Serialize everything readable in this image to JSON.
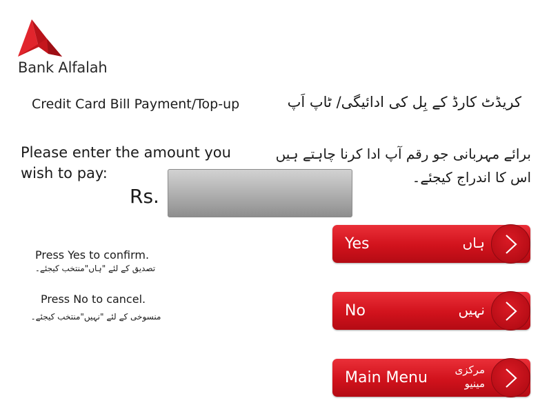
{
  "brand": {
    "name": "Bank Alfalah",
    "logo_icon": "alfalah-logo-icon",
    "color": "#d6191e"
  },
  "title": {
    "english": "Credit Card Bill Payment/Top-up",
    "urdu": "کریڈٹ کارڈ کے بِل کی ادائیگی/ ٹاپ اَپ"
  },
  "prompt": {
    "english": "Please enter the amount you wish to pay:",
    "urdu_line1": "برائے مہربانی جو رقم آپ ادا کرنا چاہتے ہیں",
    "urdu_line2": "اس کا اندراج کیجئے۔"
  },
  "amount": {
    "currency": "Rs.",
    "value": ""
  },
  "hints": {
    "yes_english": "Press Yes to confirm.",
    "yes_urdu": "تصدیق کے لئے \"ہاں\"منتخب کیجئے۔",
    "no_english": "Press No to cancel.",
    "no_urdu": "منسوخی کے لئے \"نہیں\"منتخب کیجئے۔"
  },
  "buttons": {
    "yes": {
      "english": "Yes",
      "urdu": "ہاں",
      "icon": "chevron-right-icon"
    },
    "no": {
      "english": "No",
      "urdu": "نہیں",
      "icon": "chevron-right-icon"
    },
    "main_menu": {
      "english": "Main Menu",
      "urdu_line1": "مرکزی",
      "urdu_line2": "مینیو",
      "icon": "chevron-right-icon"
    }
  },
  "colors": {
    "button_red": "#d1121c",
    "input_gray": "#b4b4b4"
  }
}
